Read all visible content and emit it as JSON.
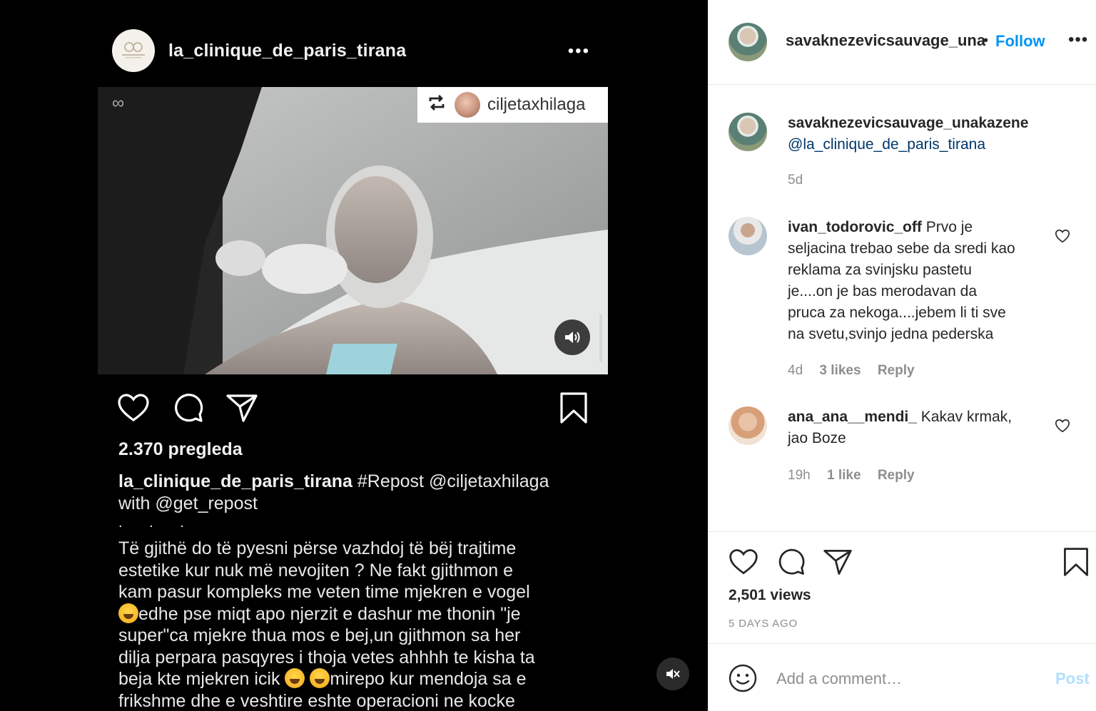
{
  "left_post": {
    "username": "la_clinique_de_paris_tirana",
    "more_label": "•••",
    "repost_tag": {
      "icon": "repost-icon",
      "username": "ciljetaxhilaga"
    },
    "views": "2.370 pregleda",
    "caption": {
      "username": "la_clinique_de_paris_tirana",
      "line1_rest": "#Repost @ciljetaxhilaga",
      "line2": "with @get_repost",
      "dots": ". . .",
      "body_l1": "Të gjithë do të pyesni përse vazhdoj të bëj trajtime",
      "body_l2": "estetike kur nuk më nevojiten ? Ne fakt gjithmon e",
      "body_l3": "kam pasur kompleks me veten time mjekren e vogel",
      "body_l4": "edhe pse miqt apo njerzit e dashur me thonin \"je",
      "body_l5": "super\"ca mjekre thua mos e bej,un gjithmon sa her",
      "body_l6": "dilja perpara pasqyres i thoja vetes ahhhh te kisha ta",
      "body_l7a": "beja kte mjekren icik ",
      "body_l7b": "mirepo kur mendoja sa e",
      "body_l8": "frikshme dhe e veshtire eshte operacioni ne kocke"
    }
  },
  "right_panel": {
    "header": {
      "username": "savaknezevicsauvage_una",
      "dot": "•",
      "follow_label": "Follow",
      "more_label": "•••"
    },
    "owner_comment": {
      "username": "savaknezevicsauvage_unakazene",
      "mention": "@la_clinique_de_paris_tirana",
      "time": "5d"
    },
    "comments": [
      {
        "username": "ivan_todorovic_off",
        "text_l1": " Prvo je",
        "text_l2": "seljacina trebao sebe da sredi kao",
        "text_l3": "reklama za svinjsku pastetu",
        "text_l4": "je....on je bas merodavan da",
        "text_l5": "pruca za nekoga....jebem li ti sve",
        "text_l6": "na svetu,svinjo jedna pederska",
        "time": "4d",
        "likes": "3 likes",
        "reply": "Reply"
      },
      {
        "username": "ana_ana__mendi_",
        "text_l1": " Kakav krmak,",
        "text_l2": "jao Boze",
        "time": "19h",
        "likes": "1 like",
        "reply": "Reply"
      }
    ],
    "views": "2,501 views",
    "date": "5 DAYS AGO",
    "add_comment_placeholder": "Add a comment…",
    "post_label": "Post"
  },
  "colors": {
    "link_blue": "#0095f6",
    "mention_blue": "#00376b",
    "post_disabled": "#b2dffc",
    "meta_gray": "#8e8e8e"
  }
}
